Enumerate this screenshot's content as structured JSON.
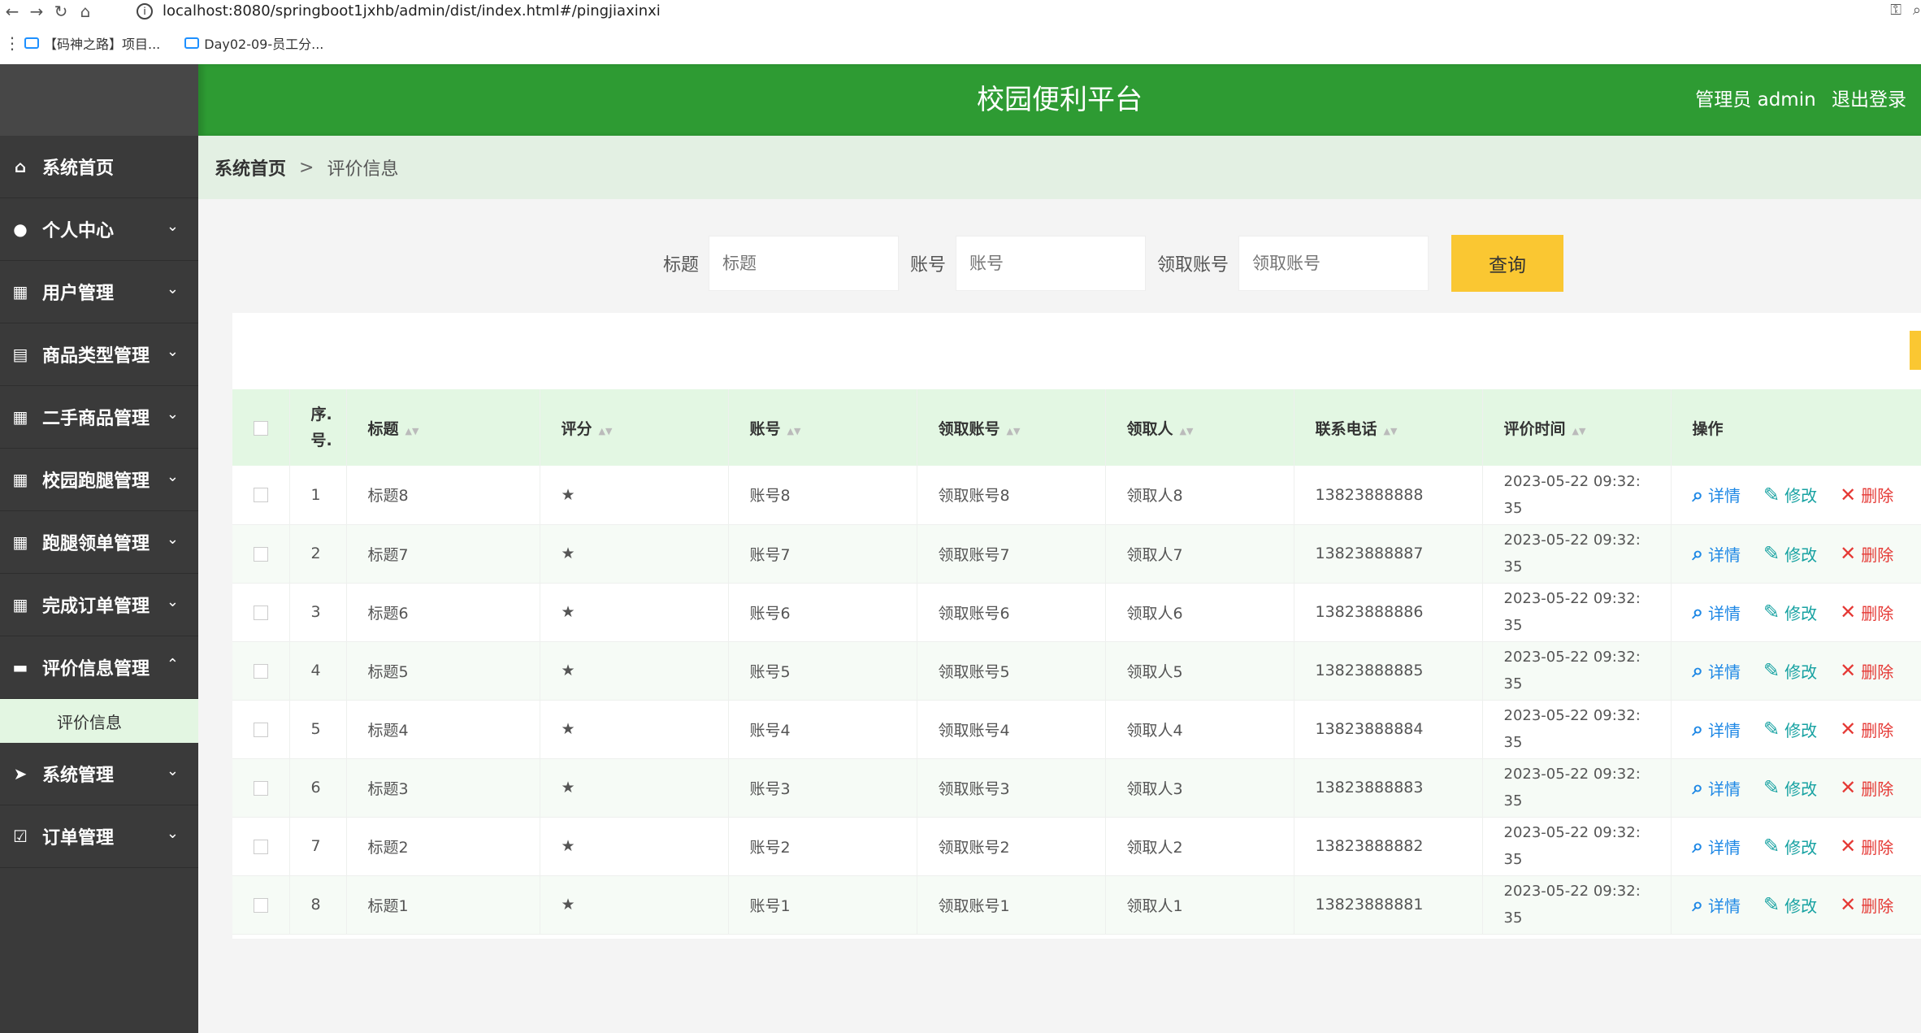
{
  "browser": {
    "url": "localhost:8080/springboot1jxhb/admin/dist/index.html#/pingjiaxinxi",
    "bookmarks": [
      "【码神之路】项目...",
      "Day02-09-员工分..."
    ]
  },
  "header": {
    "title": "校园便利平台",
    "user": "管理员 admin",
    "logout": "退出登录"
  },
  "sidebar": {
    "items": [
      {
        "label": "系统首页",
        "icon": "home-icon"
      },
      {
        "label": "个人中心",
        "icon": "user-icon"
      },
      {
        "label": "用户管理",
        "icon": "grid-icon"
      },
      {
        "label": "商品类型管理",
        "icon": "clipboard-icon"
      },
      {
        "label": "二手商品管理",
        "icon": "grid-icon"
      },
      {
        "label": "校园跑腿管理",
        "icon": "grid-icon"
      },
      {
        "label": "跑腿领单管理",
        "icon": "grid-icon"
      },
      {
        "label": "完成订单管理",
        "icon": "grid-icon"
      },
      {
        "label": "评价信息管理",
        "icon": "comment-icon"
      },
      {
        "label": "系统管理",
        "icon": "send-icon"
      },
      {
        "label": "订单管理",
        "icon": "check-clipboard-icon"
      }
    ],
    "sub_item": "评价信息"
  },
  "breadcrumb": {
    "home": "系统首页",
    "separator": ">",
    "current": "评价信息"
  },
  "search": {
    "fields": [
      {
        "label": "标题",
        "placeholder": "标题"
      },
      {
        "label": "账号",
        "placeholder": "账号"
      },
      {
        "label": "领取账号",
        "placeholder": "领取账号"
      }
    ],
    "button": "查询"
  },
  "table": {
    "headers": [
      "序.号.",
      "标题",
      "评分",
      "账号",
      "领取账号",
      "领取人",
      "联系电话",
      "评价时间",
      "操作"
    ],
    "actions": {
      "detail": "详情",
      "edit": "修改",
      "delete": "删除"
    },
    "rows": [
      {
        "no": "1",
        "title": "标题8",
        "score": "★",
        "account": "账号8",
        "recv_account": "领取账号8",
        "receiver": "领取人8",
        "phone": "13823888888",
        "time1": "2023-05-22 09:32:",
        "time2": "35"
      },
      {
        "no": "2",
        "title": "标题7",
        "score": "★",
        "account": "账号7",
        "recv_account": "领取账号7",
        "receiver": "领取人7",
        "phone": "13823888887",
        "time1": "2023-05-22 09:32:",
        "time2": "35"
      },
      {
        "no": "3",
        "title": "标题6",
        "score": "★",
        "account": "账号6",
        "recv_account": "领取账号6",
        "receiver": "领取人6",
        "phone": "13823888886",
        "time1": "2023-05-22 09:32:",
        "time2": "35"
      },
      {
        "no": "4",
        "title": "标题5",
        "score": "★",
        "account": "账号5",
        "recv_account": "领取账号5",
        "receiver": "领取人5",
        "phone": "13823888885",
        "time1": "2023-05-22 09:32:",
        "time2": "35"
      },
      {
        "no": "5",
        "title": "标题4",
        "score": "★",
        "account": "账号4",
        "recv_account": "领取账号4",
        "receiver": "领取人4",
        "phone": "13823888884",
        "time1": "2023-05-22 09:32:",
        "time2": "35"
      },
      {
        "no": "6",
        "title": "标题3",
        "score": "★",
        "account": "账号3",
        "recv_account": "领取账号3",
        "receiver": "领取人3",
        "phone": "13823888883",
        "time1": "2023-05-22 09:32:",
        "time2": "35"
      },
      {
        "no": "7",
        "title": "标题2",
        "score": "★",
        "account": "账号2",
        "recv_account": "领取账号2",
        "receiver": "领取人2",
        "phone": "13823888882",
        "time1": "2023-05-22 09:32:",
        "time2": "35"
      },
      {
        "no": "8",
        "title": "标题1",
        "score": "★",
        "account": "账号1",
        "recv_account": "领取账号1",
        "receiver": "领取人1",
        "phone": "13823888881",
        "time1": "2023-05-22 09:32:",
        "time2": "35"
      }
    ]
  },
  "colors": {
    "header_green": "#2e9b33",
    "sidebar_dark": "#3a3a3a",
    "accent_yellow": "#fac732",
    "table_header_bg": "#e3f7e3"
  }
}
